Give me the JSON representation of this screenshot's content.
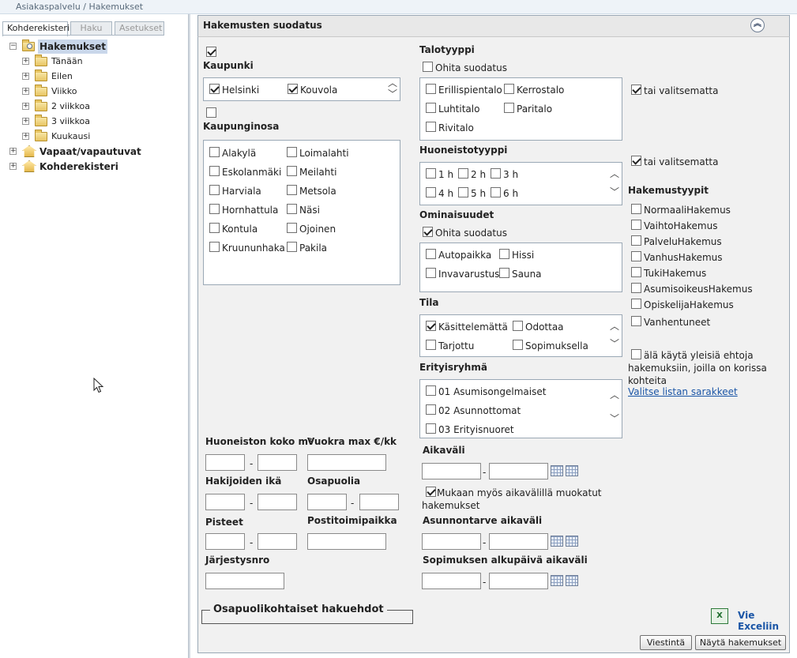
{
  "breadcrumb": "Asiakaspalvelu / Hakemukset",
  "left_tabs": [
    "Kohderekisteri",
    "Haku",
    "Asetukset"
  ],
  "tree": {
    "root": "Hakemukset",
    "children": [
      "Tänään",
      "Eilen",
      "Viikko",
      "2 viikkoa",
      "3 viikkoa",
      "Kuukausi"
    ],
    "other_roots": [
      "Vapaat/vapautuvat",
      "Kohderekisteri"
    ]
  },
  "panel": {
    "title": "Hakemusten suodatus"
  },
  "kaupunki": {
    "label": "Kaupunki",
    "items": [
      {
        "label": "Helsinki",
        "checked": true
      },
      {
        "label": "Kouvola",
        "checked": true
      }
    ]
  },
  "kaupunginosa": {
    "label": "Kaupunginosa",
    "col1": [
      "Alakylä",
      "Eskolanmäki",
      "Harviala",
      "Hornhattula",
      "Kontula",
      "Kruununhaka"
    ],
    "col2": [
      "Loimalahti",
      "Meilahti",
      "Metsola",
      "Näsi",
      "Ojoinen",
      "Pakila"
    ]
  },
  "talotyyppi": {
    "label": "Talotyyppi",
    "skip": "Ohita suodatus",
    "items": [
      "Erillispientalo",
      "Kerrostalo",
      "Luhtitalo",
      "Paritalo",
      "Rivitalo"
    ],
    "or_unselected": "tai valitsematta"
  },
  "huoneistotyyppi": {
    "label": "Huoneistotyyppi",
    "items": [
      "1 h",
      "2 h",
      "3 h",
      "4 h",
      "5 h",
      "6 h"
    ],
    "or_unselected": "tai valitsematta"
  },
  "ominaisuudet": {
    "label": "Ominaisuudet",
    "skip": "Ohita suodatus",
    "items": [
      "Autopaikka",
      "Hissi",
      "Invavarustus",
      "Sauna"
    ]
  },
  "tila": {
    "label": "Tila",
    "items": [
      "Käsittelemättä",
      "Odottaa",
      "Tarjottu",
      "Sopimuksella"
    ]
  },
  "erityisryhma": {
    "label": "Erityisryhmä",
    "items": [
      "01 Asumisongelmaiset",
      "02 Asunnottomat",
      "03 Erityisnuoret"
    ]
  },
  "hakemustyypit": {
    "label": "Hakemustyypit",
    "items": [
      "NormaaliHakemus",
      "VaihtoHakemus",
      "PalveluHakemus",
      "VanhusHakemus",
      "TukiHakemus",
      "AsumisoikeusHakemus",
      "OpiskelijaHakemus",
      "Vanhentuneet"
    ],
    "general_conditions": "älä käytä yleisiä ehtoja hakemuksiin, joilla on korissa kohteita",
    "columns_link": "Valitse listan sarakkeet"
  },
  "fields": {
    "koko": "Huoneiston koko m²",
    "vuokra": "Vuokra max €/kk",
    "ika": "Hakijoiden ikä",
    "osapuolia": "Osapuolia",
    "pisteet": "Pisteet",
    "postitoimipaikka": "Postitoimipaikka",
    "jarjestysnro": "Järjestysnro",
    "aikavali": "Aikaväli",
    "mukaan": "Mukaan myös aikavälillä muokatut hakemukset",
    "asunnontarve": "Asunnontarve aikaväli",
    "sopimus": "Sopimuksen alkupäivä aikaväli",
    "dash": "-"
  },
  "osapuoli_legend": "Osapuolikohtaiset hakuehdot",
  "excel": {
    "icon_text": "X",
    "label": "Vie Exceliin"
  },
  "buttons": {
    "viestinta": "Viestintä",
    "nayta": "Näytä hakemukset"
  },
  "colors": {
    "accent": "#1a55a6",
    "panel": "#f1f1f1",
    "border": "#9aa8b5"
  }
}
